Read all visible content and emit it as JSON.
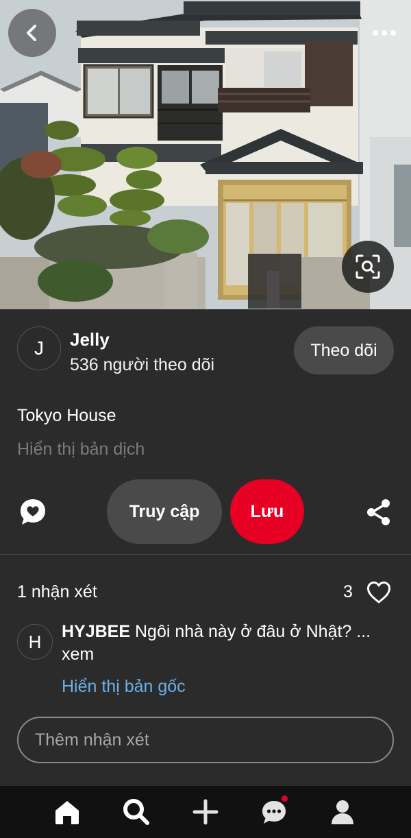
{
  "pin": {
    "title": "Tokyo House",
    "translate_label": "Hiển thị bản dịch"
  },
  "author": {
    "avatar_initial": "J",
    "name": "Jelly",
    "followers": "536 người theo dõi",
    "follow_label": "Theo dõi"
  },
  "actions": {
    "visit_label": "Truy cập",
    "save_label": "Lưu",
    "save_color": "#e60023"
  },
  "comments": {
    "count_label": "1 nhận xét",
    "likes": "3",
    "items": [
      {
        "avatar_initial": "H",
        "author": "HYJBEE",
        "text": "Ngôi nhà này ở đâu ở Nhật? ... xem",
        "show_original_label": "Hiển thị bản gốc"
      }
    ],
    "add_placeholder": "Thêm nhận xét"
  },
  "nav": {
    "items": [
      "home-icon",
      "search-icon",
      "plus-icon",
      "messages-icon",
      "profile-icon"
    ],
    "active": "search-icon"
  }
}
